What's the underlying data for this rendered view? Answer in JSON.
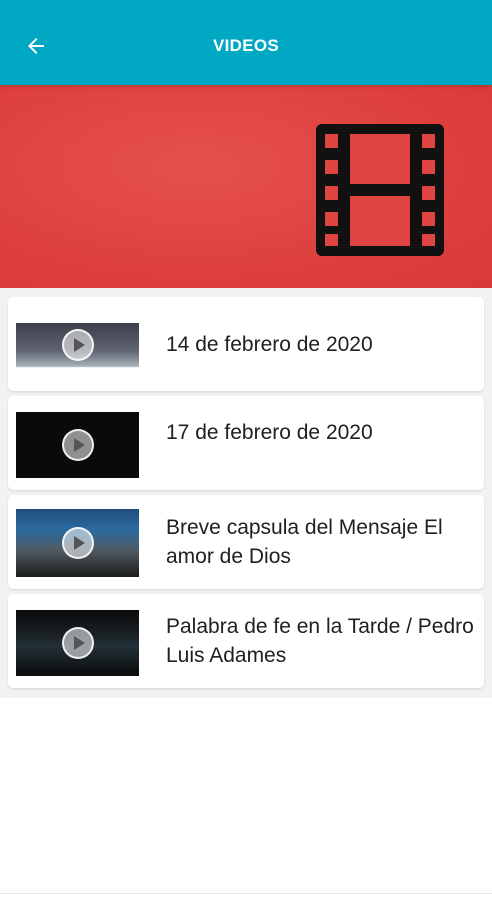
{
  "appbar": {
    "title": "VIDEOS",
    "background": "#00a8c4",
    "back_icon": "arrow-left-icon"
  },
  "banner": {
    "background": "#e04441",
    "icon": "film-strip-icon"
  },
  "videos": [
    {
      "title": "14 de febrero de 2020"
    },
    {
      "title": "17 de febrero de 2020"
    },
    {
      "title": "Breve capsula del Mensaje El amor de Dios"
    },
    {
      "title": "Palabra de fe en la Tarde / Pedro Luis Adames"
    }
  ],
  "thumbnail_overlay_icon": "play-icon"
}
